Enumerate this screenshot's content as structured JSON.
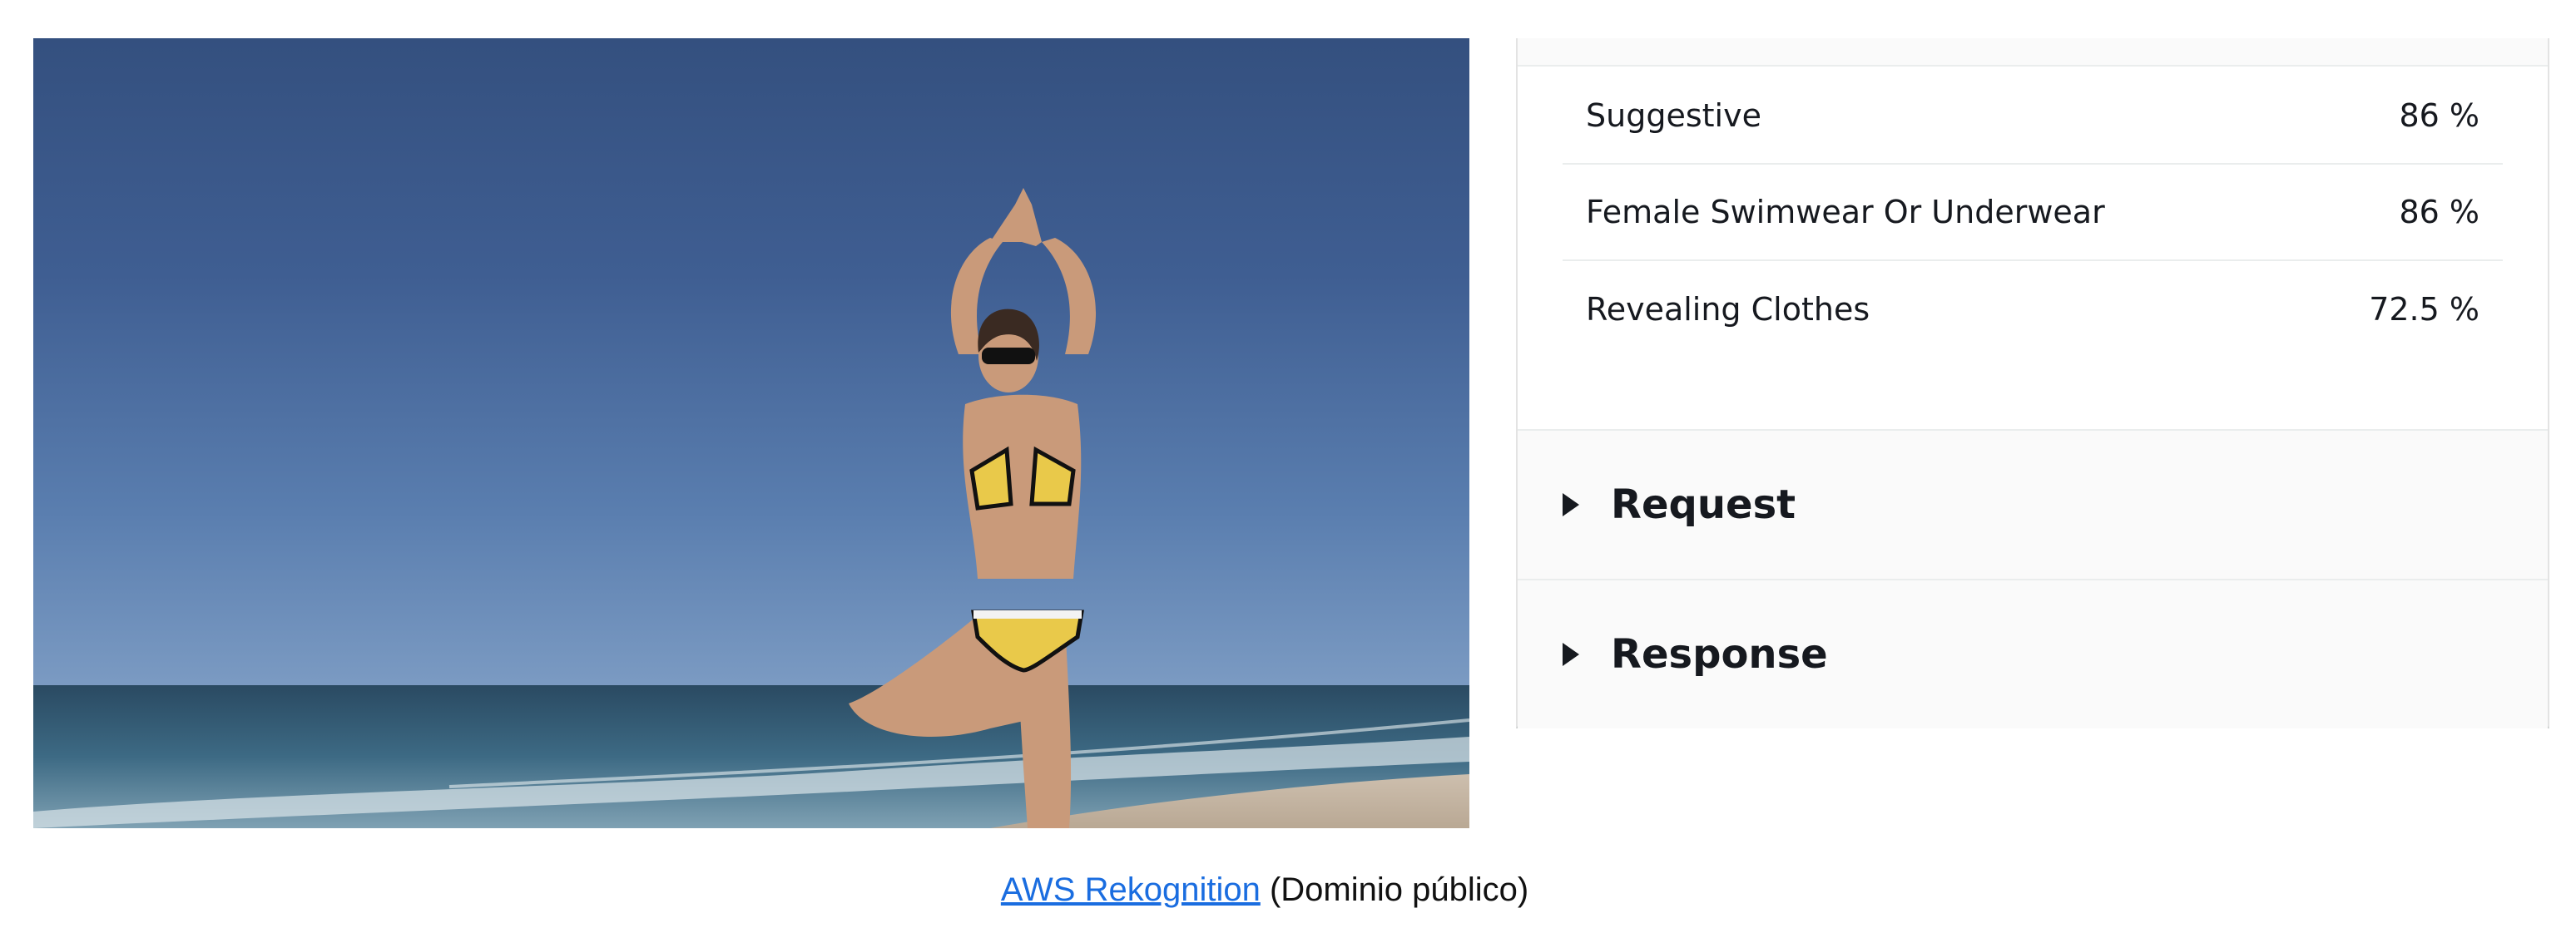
{
  "photo": {
    "kind": "photograph",
    "subject": "woman in yellow bikini doing tree yoga pose on beach"
  },
  "labels": [
    {
      "name": "Suggestive",
      "confidence": "86 %"
    },
    {
      "name": "Female Swimwear Or Underwear",
      "confidence": "86 %"
    },
    {
      "name": "Revealing Clothes",
      "confidence": "72.5 %"
    }
  ],
  "sections": {
    "request_title": "Request",
    "response_title": "Response"
  },
  "caption": {
    "link_text": "AWS Rekognition",
    "suffix": " (Dominio público)"
  },
  "colors": {
    "link": "#1a6de0",
    "text": "#16191f",
    "panel_bg": "#fafafa"
  },
  "icons": [
    "caret-right-icon"
  ]
}
